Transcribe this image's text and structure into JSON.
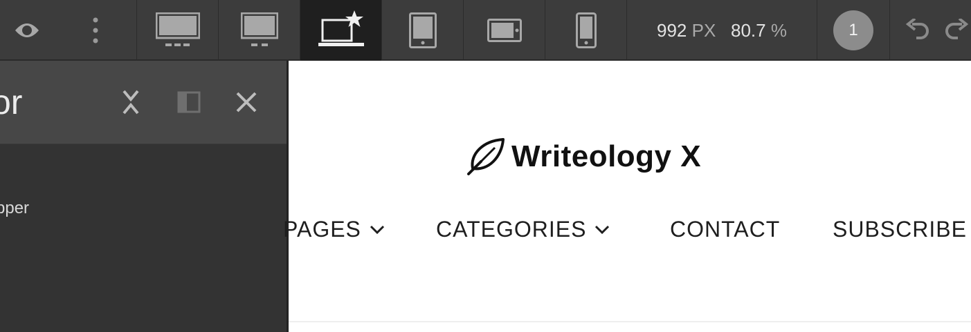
{
  "toolbar": {
    "width_value": "992",
    "width_unit": "PX",
    "zoom_value": "80.7",
    "zoom_unit": "%",
    "notification_count": "1"
  },
  "panel": {
    "title_fragment": "or",
    "item_fragment": "pper"
  },
  "site": {
    "logo_text": "Writeology X",
    "nav": [
      "PAGES",
      "CATEGORIES",
      "CONTACT",
      "SUBSCRIBE"
    ]
  },
  "icons": {
    "toolbar": [
      "eye-icon",
      "more-vertical-icon",
      "desktop-wide-icon",
      "desktop-icon",
      "laptop-star-icon",
      "tablet-portrait-icon",
      "tablet-landscape-icon",
      "mobile-icon",
      "undo-icon",
      "redo-icon"
    ],
    "panel": [
      "collapse-icon",
      "dock-icon",
      "close-icon"
    ],
    "site": [
      "feather-pen-icon",
      "chevron-down-icon"
    ]
  },
  "colors": {
    "toolbar_bg": "#3c3c3c",
    "active_tab_bg": "#1f1f1f",
    "panel_bg": "#333333",
    "panel_header_bg": "#474747",
    "badge_bg": "#8c8c8c"
  }
}
